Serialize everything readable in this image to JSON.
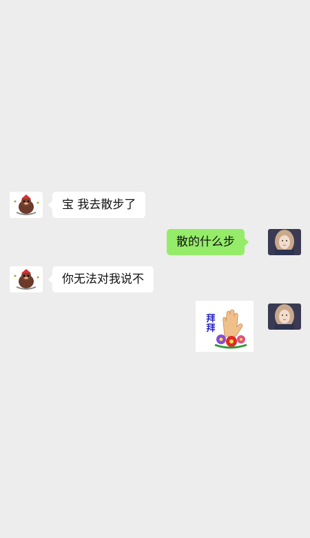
{
  "chat": {
    "messages": [
      {
        "side": "left",
        "type": "text",
        "text": "宝 我去散步了"
      },
      {
        "side": "right",
        "type": "text",
        "text": "散的什么步"
      },
      {
        "side": "left",
        "type": "text",
        "text": "你无法对我说不"
      },
      {
        "side": "right",
        "type": "sticker",
        "sticker_text": "拜拜",
        "sticker_icon": "waving-hand-with-flowers"
      }
    ]
  },
  "colors": {
    "background": "#ededed",
    "incoming_bubble": "#ffffff",
    "outgoing_bubble": "#95ec69",
    "sticker_text": "#2323c8"
  }
}
